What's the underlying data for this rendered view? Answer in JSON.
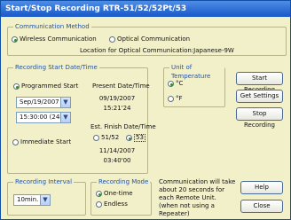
{
  "window": {
    "title": "Start/Stop Recording RTR-51/52/52Pt/53"
  },
  "communication": {
    "legend": "Communication Method",
    "wireless": "Wireless Communication",
    "optical": "Optical Communication",
    "location": "Location for Optical Communication:Japanese-9W"
  },
  "recording_start": {
    "legend": "Recording Start Date/Time",
    "programmed": "Programmed Start",
    "date": "Sep/19/2007",
    "time": "15:30:00 (24h)",
    "immediate": "Immediate Start",
    "present_label": "Present Date/Time",
    "present_date": "09/19/2007",
    "present_time": "15:21'24",
    "est_label": "Est. Finish Date/Time",
    "opt1": "51/52",
    "opt2": "53",
    "finish_date": "11/14/2007",
    "finish_time": "03:40'00"
  },
  "unit_temp": {
    "legend": "Unit of Temperature",
    "celsius": "°C",
    "fahrenheit": "°F"
  },
  "interval": {
    "legend": "Recording Interval",
    "value": "10min."
  },
  "mode": {
    "legend": "Recording Mode",
    "one_time": "One-time",
    "endless": "Endless"
  },
  "note": [
    "Communication will take",
    "about 20 seconds for",
    "each Remote Unit.",
    "(when not using a",
    "Repeater)"
  ],
  "buttons": {
    "start": "Start Recording",
    "get_settings": "Get Settings",
    "stop": "Stop Recording",
    "help": "Help",
    "close": "Close"
  }
}
